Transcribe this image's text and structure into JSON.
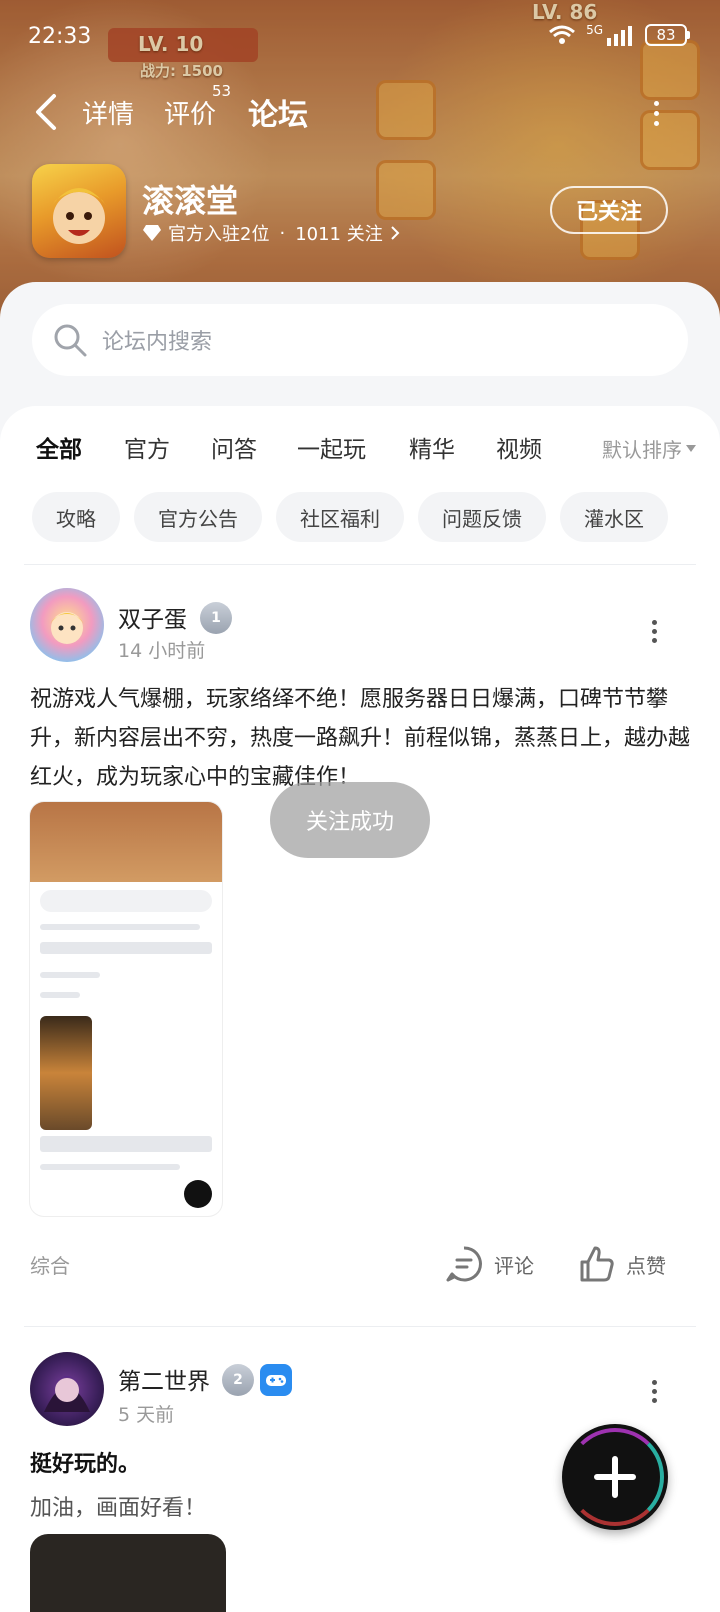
{
  "status_bar": {
    "time": "22:33",
    "network": "5G",
    "battery": "83"
  },
  "banner": {
    "left_level": "LV. 10",
    "left_power": "战力: 1500",
    "right_level": "LV. 86"
  },
  "nav": {
    "tabs": [
      {
        "label": "详情",
        "active": false
      },
      {
        "label": "评价",
        "active": false,
        "badge": "53"
      },
      {
        "label": "论坛",
        "active": true
      }
    ]
  },
  "game": {
    "name": "滚滚堂",
    "meta_official": "官方入驻2位",
    "meta_dot": "·",
    "meta_followers": "1011 关注",
    "follow_button": "已关注"
  },
  "search": {
    "placeholder": "论坛内搜索"
  },
  "category_tabs": [
    {
      "label": "全部",
      "active": true
    },
    {
      "label": "官方",
      "active": false
    },
    {
      "label": "问答",
      "active": false
    },
    {
      "label": "一起玩",
      "active": false
    },
    {
      "label": "精华",
      "active": false
    },
    {
      "label": "视频",
      "active": false
    }
  ],
  "sort": {
    "label": "默认排序"
  },
  "chips": [
    "攻略",
    "官方公告",
    "社区福利",
    "问题反馈",
    "灌水区"
  ],
  "posts": [
    {
      "user": "双子蛋",
      "level": "1",
      "time": "14 小时前",
      "text": "祝游戏人气爆棚，玩家络绎不绝！愿服务器日日爆满，口碑节节攀升，新内容层出不穷，热度一路飙升！前程似锦，蒸蒸日上，越办越红火，成为玩家心中的宝藏佳作！",
      "tag": "综合",
      "comment_label": "评论",
      "like_label": "点赞"
    },
    {
      "user": "第二世界",
      "level": "2",
      "time": "5 天前",
      "title": "挺好玩的。",
      "body": "加油，画面好看！"
    }
  ],
  "toast": "关注成功",
  "colors": {
    "accent": "#2fd6c6",
    "banner": "#c98a55",
    "fab": "#111111"
  }
}
